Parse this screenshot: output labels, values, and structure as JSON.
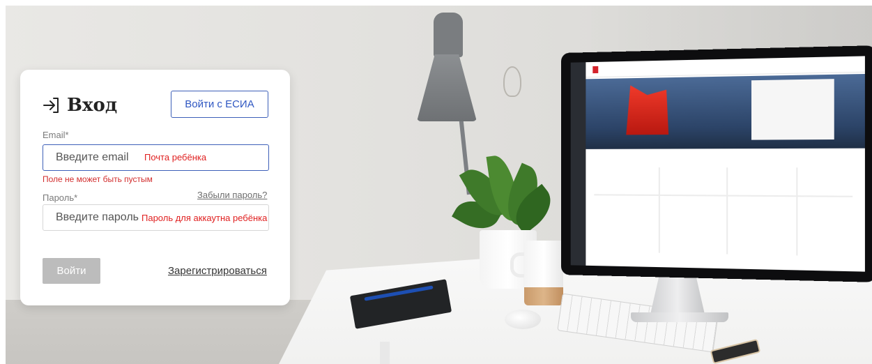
{
  "login": {
    "title": "Вход",
    "title_icon": "login-arrow-icon",
    "esia_button_label": "Войти с ЕСИА",
    "email": {
      "label": "Email*",
      "placeholder": "Введите email",
      "hint": "Почта ребёнка",
      "error": "Поле не может быть пустым"
    },
    "password": {
      "label": "Пароль*",
      "placeholder": "Введите пароль",
      "hint": "Пароль для аккаутна ребёнка",
      "forgot_label": "Забыли пароль?"
    },
    "submit_label": "Войти",
    "register_label": "Зарегистрироваться"
  },
  "colors": {
    "accent": "#3d5fb8",
    "error": "#d22d2d",
    "hint": "#e02020",
    "disabled_button": "#bcbcbc"
  }
}
